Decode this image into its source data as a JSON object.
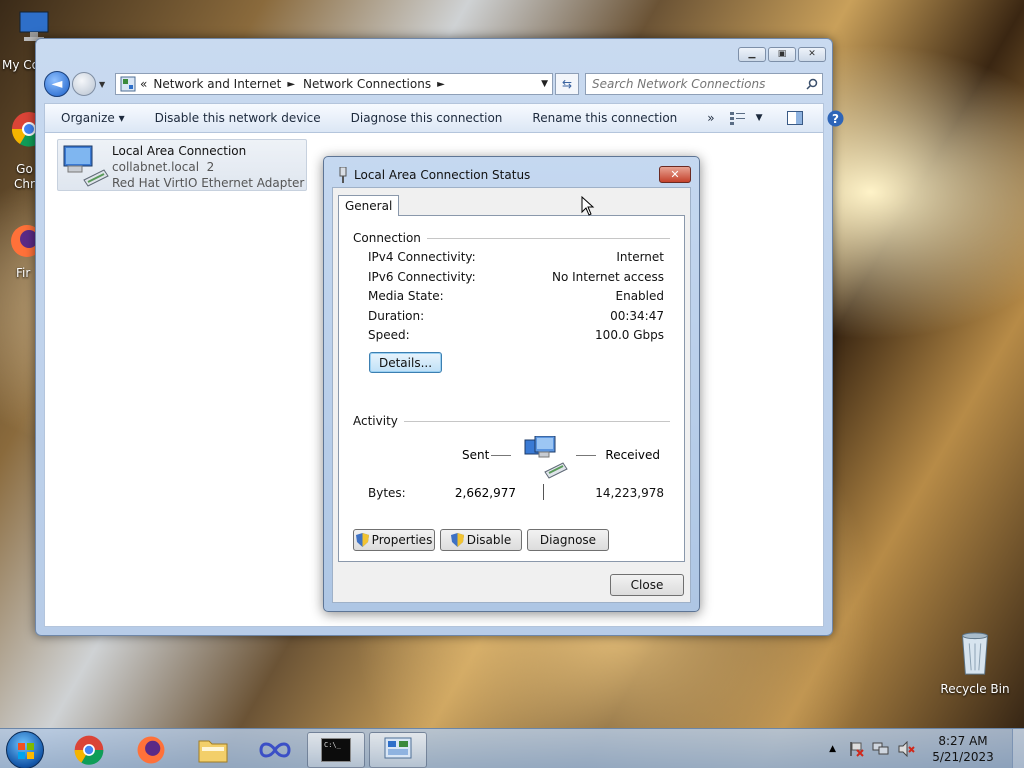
{
  "desktop": {
    "icons": [
      {
        "label": "My Co"
      },
      {
        "label": "Go\nChr"
      },
      {
        "label": "Fir"
      },
      {
        "label": "Recycle Bin"
      }
    ]
  },
  "explorer": {
    "address": {
      "overflow": "«",
      "crumbs": [
        "Network and Internet",
        "Network Connections"
      ],
      "separator": "►"
    },
    "search": {
      "placeholder": "Search Network Connections"
    },
    "toolbar": {
      "organize": "Organize ▾",
      "disable": "Disable this network device",
      "diagnose": "Diagnose this connection",
      "rename": "Rename this connection",
      "more": "»"
    },
    "connection": {
      "name": "Local Area Connection",
      "network": "collabnet.local  2",
      "adapter": "Red Hat VirtIO Ethernet Adapter"
    }
  },
  "dialog": {
    "title": "Local Area Connection Status",
    "close_glyph": "✕",
    "tab": "General",
    "connection_group": "Connection",
    "rows": [
      {
        "label": "IPv4 Connectivity:",
        "value": "Internet"
      },
      {
        "label": "IPv6 Connectivity:",
        "value": "No Internet access"
      },
      {
        "label": "Media State:",
        "value": "Enabled"
      },
      {
        "label": "Duration:",
        "value": "00:34:47"
      },
      {
        "label": "Speed:",
        "value": "100.0 Gbps"
      }
    ],
    "details_button": "Details...",
    "activity_group": "Activity",
    "sent_label": "Sent",
    "received_label": "Received",
    "bytes_label": "Bytes:",
    "bytes_sent": "2,662,977",
    "bytes_received": "14,223,978",
    "properties_button": "Properties",
    "disable_button": "Disable",
    "diagnose_button": "Diagnose",
    "close_button": "Close"
  },
  "taskbar": {
    "clock_time": "8:27 AM",
    "clock_date": "5/21/2023"
  }
}
